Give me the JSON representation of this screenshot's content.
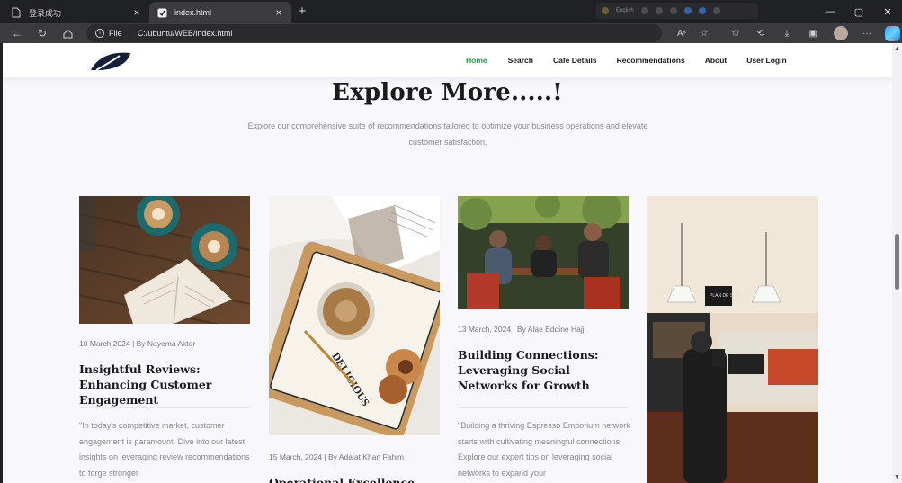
{
  "browser": {
    "tabs": [
      {
        "label": "登录成功",
        "icon": "page-icon",
        "active": false
      },
      {
        "label": "index.html",
        "icon": "html-file-icon",
        "active": true
      }
    ],
    "floating_label": "English",
    "address": {
      "scheme": "File",
      "path": "C:/ubuntu/WEB/index.html"
    },
    "accent": "#3b3b40"
  },
  "site": {
    "nav": [
      {
        "label": "Home",
        "active": true
      },
      {
        "label": "Search",
        "active": false
      },
      {
        "label": "Cafe Details",
        "active": false
      },
      {
        "label": "Recommendations",
        "active": false
      },
      {
        "label": "About",
        "active": false
      },
      {
        "label": "User Login",
        "active": false
      }
    ],
    "active_color": "#1aa340",
    "heading": "Explore More.....!",
    "subtext": "Explore our comprehensive suite of recommendations tailored to optimize your business operations and elevate customer satisfaction."
  },
  "cards": [
    {
      "meta": "10 March 2024 | By Nayema Akter",
      "title": "Insightful Reviews: Enhancing Customer Engagement",
      "excerpt": "\"In today's competitive market, customer engagement is paramount. Dive into our latest insights on leveraging review recommendations to forge stronger",
      "image": "coffee-and-book-photo"
    },
    {
      "meta": "15 March, 2024 | By Adalat Khan Fahim",
      "title": "Operational Excellence",
      "excerpt": "",
      "image": "latte-and-cookies-photo"
    },
    {
      "meta": "13 March, 2024 | By Alae Eddine Hajji",
      "title": "Building Connections: Leveraging Social Networks for Growth",
      "excerpt": "\"Building a thriving Espresso Emporium network starts with cultivating meaningful connections. Explore our expert tips on leveraging social networks to expand your",
      "image": "friends-at-cafe-photo"
    },
    {
      "meta": "",
      "title": "",
      "excerpt": "",
      "image": "cafe-counter-photo",
      "sign_text": "PLAN DE SUNI"
    }
  ]
}
